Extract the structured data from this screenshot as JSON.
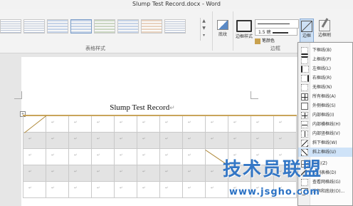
{
  "window": {
    "title": "Slump Test Record.docx - Word"
  },
  "ribbon": {
    "table_styles_label": "表格样式",
    "shading_label": "底纹",
    "border_styles_label": "边框样式",
    "line_width": "1.5 磅",
    "pen_color_label": "笔颜色",
    "borders_group_label": "边框",
    "borders_button_label": "边框",
    "border_painter_label": "边框刷"
  },
  "document": {
    "title": "Slump Test Record",
    "paragraph_mark": "↵",
    "cell_mark": "↵",
    "move_handle": "+"
  },
  "borders_menu": {
    "items": [
      {
        "label": "下框线(B)"
      },
      {
        "label": "上框线(P)"
      },
      {
        "label": "左框线(L)"
      },
      {
        "label": "右框线(R)"
      },
      {
        "label": "无框线(N)"
      },
      {
        "label": "所有框线(A)"
      },
      {
        "label": "外侧框线(S)"
      },
      {
        "label": "内部框线(I)"
      },
      {
        "label": "内部横框线(H)"
      },
      {
        "label": "内部竖框线(V)"
      },
      {
        "label": "斜下框线(W)"
      },
      {
        "label": "斜上框线(U)"
      },
      {
        "label": "横线(Z)"
      },
      {
        "label": "绘制表格(D)"
      },
      {
        "label": "查看网格线(G)"
      },
      {
        "label": "边框和底纹(O)..."
      }
    ]
  },
  "watermark": {
    "main": "技术员联盟",
    "url": "www.jsgho.com"
  },
  "colors": {
    "accent": "#2a71c4",
    "menu_highlight": "#cfe3f8",
    "table_top_border": "#c9a45a"
  }
}
